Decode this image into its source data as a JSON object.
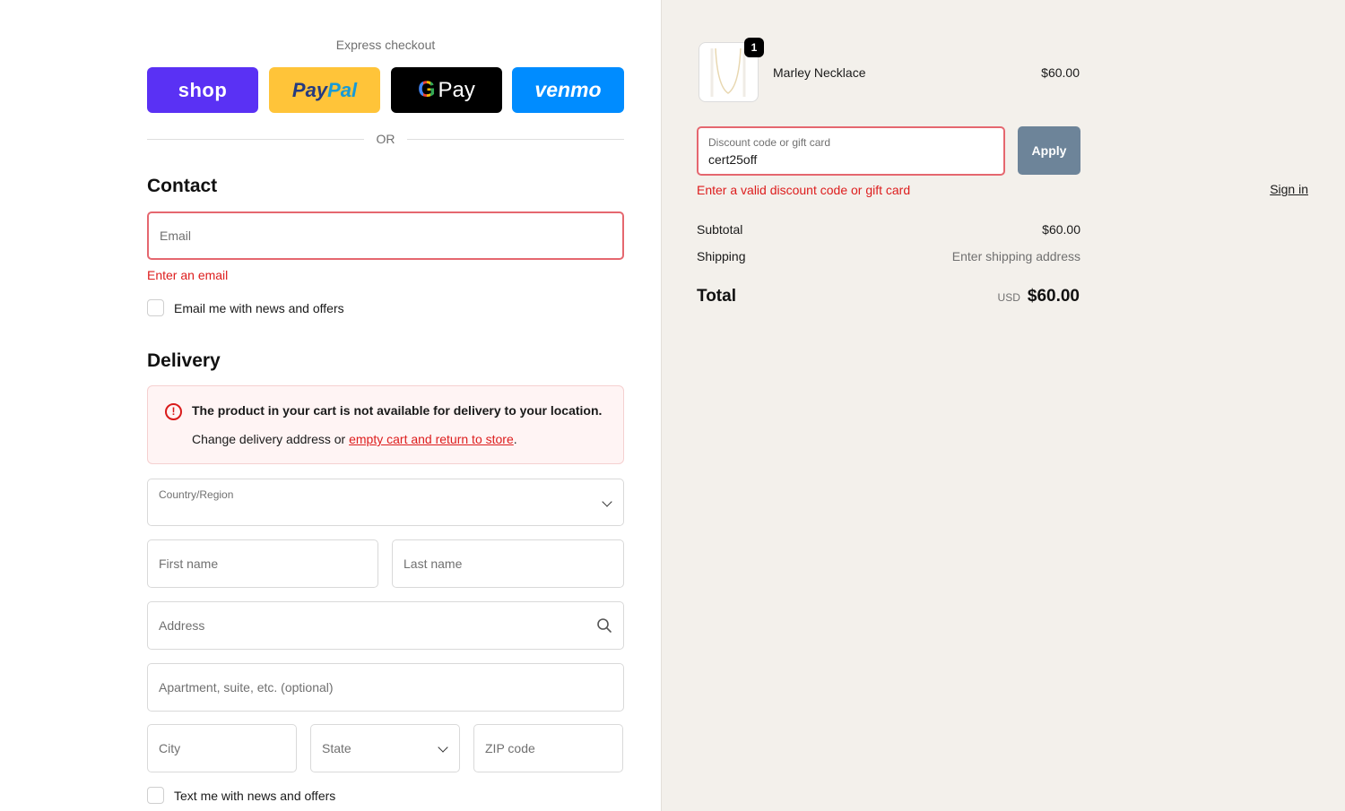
{
  "express": {
    "title": "Express checkout",
    "shop_label": "shop",
    "paypal_label_1": "Pay",
    "paypal_label_2": "Pal",
    "gpay_g": "G",
    "gpay_label": "Pay",
    "venmo_label": "venmo",
    "or_text": "OR"
  },
  "contact": {
    "heading": "Contact",
    "sign_in": "Sign in",
    "email_placeholder": "Email",
    "email_error": "Enter an email",
    "news_label": "Email me with news and offers"
  },
  "delivery": {
    "heading": "Delivery",
    "alert_title": "The product in your cart is not available for delivery to your location.",
    "alert_body_prefix": "Change delivery address or ",
    "alert_link": "empty cart and return to store",
    "alert_body_suffix": ".",
    "country_label": "Country/Region",
    "first_name": "First name",
    "last_name": "Last name",
    "address": "Address",
    "apartment": "Apartment, suite, etc. (optional)",
    "city": "City",
    "state": "State",
    "zip": "ZIP code",
    "text_news_label": "Text me with news and offers"
  },
  "cart": {
    "item_name": "Marley Necklace",
    "item_price": "$60.00",
    "item_qty": "1",
    "discount_label": "Discount code or gift card",
    "discount_value": "cert25off",
    "apply_label": "Apply",
    "discount_error": "Enter a valid discount code or gift card",
    "subtotal_label": "Subtotal",
    "subtotal_value": "$60.00",
    "shipping_label": "Shipping",
    "shipping_value": "Enter shipping address",
    "total_label": "Total",
    "currency": "USD",
    "total_value": "$60.00"
  },
  "colors": {
    "shop": "#5a31f4",
    "paypal": "#ffc439",
    "gpay": "#000000",
    "venmo": "#008cff",
    "error": "#dd1d1d",
    "apply": "#6d8499",
    "summary_bg": "#f3f0eb"
  }
}
